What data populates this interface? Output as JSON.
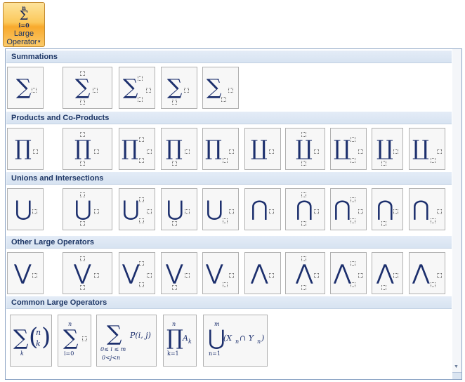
{
  "ribbon": {
    "label_line1": "Large",
    "label_line2": "Operator",
    "icon": {
      "name": "summation-icon",
      "glyph": "Σ",
      "upper": "n",
      "lower": "i=0"
    }
  },
  "sections": {
    "summations": "Summations",
    "products": "Products and Co-Products",
    "unions": "Unions and Intersections",
    "other": "Other Large Operators",
    "common": "Common Large Operators"
  },
  "glyphs": {
    "sum": "∑",
    "prod": "∏",
    "coprod": "∐",
    "union": "⋃",
    "intersect": "⋂",
    "or": "⋁",
    "and": "⋀"
  },
  "common": {
    "binom": {
      "top": "n",
      "bottom": "k",
      "sub": "k"
    },
    "sum_i": {
      "upper": "n",
      "lower": "i=0"
    },
    "sum_ij": {
      "lower1": "0≤ i ≤ m",
      "lower2": "0<j<n",
      "body": "P(i, j)"
    },
    "prod_k": {
      "upper": "n",
      "lower": "k=1",
      "body": "A",
      "body_sub": "k"
    },
    "union_n": {
      "upper": "m",
      "lower": "n=1",
      "body": "(X",
      "body_sub1": "n",
      "mid": " ∩ Y",
      "body_sub2": "n",
      "close": ")"
    }
  }
}
